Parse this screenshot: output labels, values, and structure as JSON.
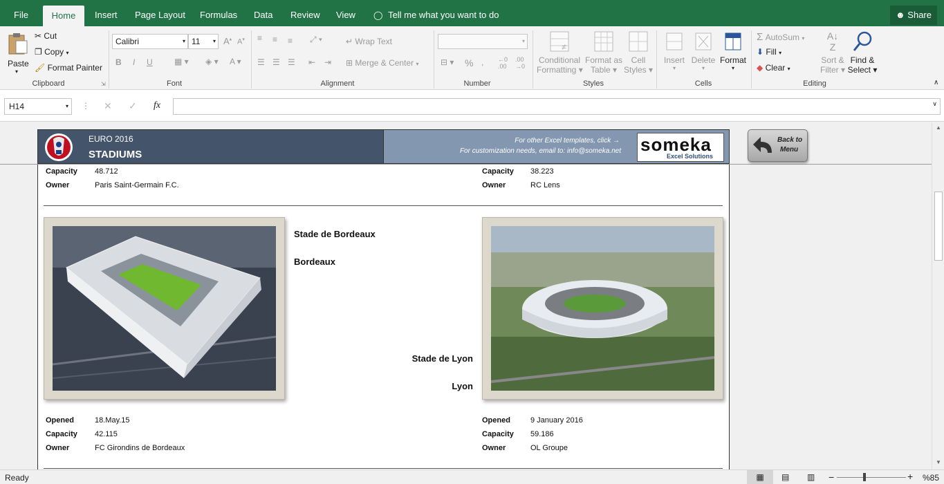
{
  "tabs": {
    "file": "File",
    "home": "Home",
    "insert": "Insert",
    "page_layout": "Page Layout",
    "formulas": "Formulas",
    "data": "Data",
    "review": "Review",
    "view": "View",
    "tell_me": "Tell me what you want to do",
    "share": "Share"
  },
  "ribbon": {
    "clipboard": {
      "paste": "Paste",
      "cut": "Cut",
      "copy": "Copy",
      "format_painter": "Format Painter",
      "label": "Clipboard"
    },
    "font": {
      "name": "Calibri",
      "size": "11",
      "bold": "B",
      "italic": "I",
      "underline": "U",
      "label": "Font"
    },
    "alignment": {
      "wrap_text": "Wrap Text",
      "merge_center": "Merge & Center",
      "label": "Alignment"
    },
    "number": {
      "format": "",
      "percent": "%",
      "label": "Number"
    },
    "styles": {
      "conditional_1": "Conditional",
      "conditional_2": "Formatting",
      "format_as_1": "Format as",
      "format_as_2": "Table",
      "cell_1": "Cell",
      "cell_2": "Styles",
      "label": "Styles"
    },
    "cells": {
      "insert": "Insert",
      "delete": "Delete",
      "format": "Format",
      "label": "Cells"
    },
    "editing": {
      "autosum": "AutoSum",
      "fill": "Fill",
      "clear": "Clear",
      "sort_1": "Sort &",
      "sort_2": "Filter",
      "find_1": "Find &",
      "find_2": "Select",
      "label": "Editing"
    }
  },
  "formula_bar": {
    "name_box": "H14",
    "fx": "fx",
    "formula": ""
  },
  "header": {
    "line1": "EURO 2016",
    "line2": "STADIUMS",
    "promo1": "For other Excel templates, click →",
    "promo2": "For customization needs, email to: info@someka.net",
    "logo_text": "someka",
    "logo_sub": "Excel Solutions",
    "back_button_1": "Back to",
    "back_button_2": "Menu"
  },
  "labels": {
    "opened": "Opened",
    "capacity": "Capacity",
    "owner": "Owner"
  },
  "top_row": {
    "left": {
      "capacity": "48.712",
      "owner": "Paris Saint-Germain F.C."
    },
    "right": {
      "capacity": "38.223",
      "owner": "RC Lens"
    }
  },
  "stadiums": {
    "left": {
      "name": "Stade de Bordeaux",
      "city": "Bordeaux",
      "opened": "18.May.15",
      "capacity": "42.115",
      "owner": "FC Girondins de Bordeaux"
    },
    "right": {
      "name": "Stade de Lyon",
      "city": "Lyon",
      "opened": "9 January 2016",
      "capacity": "59.186",
      "owner": "OL Groupe"
    }
  },
  "status": {
    "ready": "Ready",
    "zoom": "%85"
  },
  "colors": {
    "excel_green": "#217346",
    "header_dark": "#44546a",
    "header_light": "#8497b0"
  }
}
